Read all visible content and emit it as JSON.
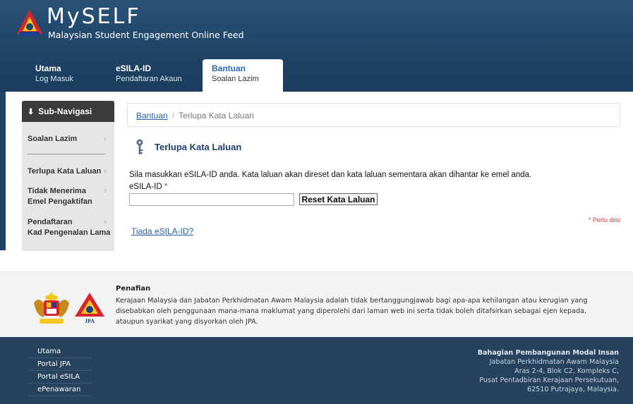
{
  "header": {
    "logo_title": "MySELF",
    "logo_subtitle": "Malaysian Student Engagement Online Feed"
  },
  "nav": {
    "items": [
      {
        "label": "Utama",
        "sub": "Log Masuk"
      },
      {
        "label": "eSILA-ID",
        "sub": "Pendaftaran Akaun"
      },
      {
        "label": "Bantuan",
        "sub": "Soalan Lazim"
      }
    ]
  },
  "subnav": {
    "heading": "Sub-Navigasi",
    "items": [
      {
        "line1": "Soalan Lazim",
        "line2": ""
      },
      {
        "line1": "Terlupa Kata Laluan",
        "line2": ""
      },
      {
        "line1": "Tidak Menerima",
        "line2": "Emel Pengaktifan"
      },
      {
        "line1": "Pendaftaran",
        "line2": "Kad Pengenalan Lama"
      }
    ]
  },
  "breadcrumb": {
    "link": "Bantuan",
    "separator": "/",
    "current": "Terlupa Kata Laluan"
  },
  "form": {
    "title": "Terlupa Kata Laluan",
    "instruction": "Sila masukkan eSILA-ID anda. Kata laluan akan direset dan kata laluan sementara akan dihantar ke emel anda.",
    "field_label": "eSILA-ID",
    "required_mark": "*",
    "input_value": "",
    "button_label": "Reset Kata Laluan",
    "required_note": "* Perlu diisi",
    "no_id_link": "Tiada eSILA-ID?"
  },
  "disclaimer": {
    "title": "Penafian",
    "text": "Kerajaan Malaysia dan Jabatan Perkhidmatan Awam Malaysia adalah tidak bertanggungjawab bagi apa-apa kehilangan atau kerugian yang disebabkan oleh penggunaan mana-mana maklumat yang diperolehi dari laman web ini serta tidak boleh ditafsirkan sebagai ejen kepada, ataupun syarikat yang disyorkan oleh JPA.",
    "jpa_label": "JPA"
  },
  "footer": {
    "links": [
      "Utama",
      "Portal JPA",
      "Portal eSILA",
      "ePenawaran"
    ],
    "address": {
      "org": "Bahagian Pembangunan Modal Insan",
      "line1": "Jabatan Perkhidmatan Awam Malaysia",
      "line2": "Aras 2-4, Blok C2, Kompleks C,",
      "line3": "Pusat Pentadbiran Kerajaan Persekutuan,",
      "line4": "62510 Putrajaya, Malaysia."
    }
  },
  "colors": {
    "header_bg": "#1f4466",
    "link": "#2a5fa6",
    "title": "#1f3f6b",
    "required": "#d33333",
    "footer_bg": "#27425d"
  }
}
